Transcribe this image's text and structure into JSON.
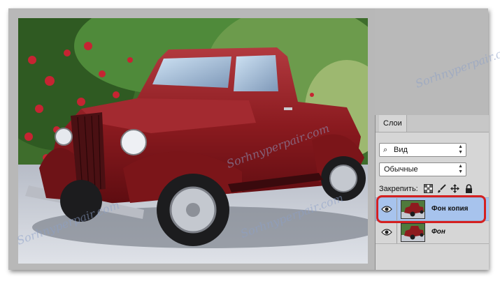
{
  "watermark": "Sorhnyperpair.com",
  "layers_panel": {
    "tab_label": "Слои",
    "filter_dropdown": {
      "icon": "search-icon",
      "value": "Вид"
    },
    "blend_dropdown": {
      "value": "Обычные"
    },
    "lock": {
      "label": "Закрепить:",
      "icons": [
        "lock-transparent-pixels-icon",
        "lock-image-pixels-icon",
        "lock-position-icon",
        "lock-all-icon"
      ]
    },
    "layers": [
      {
        "name": "Фон копия",
        "selected": true,
        "visible": true
      },
      {
        "name": "Фон",
        "selected": false,
        "visible": true
      }
    ]
  },
  "colors": {
    "selected_layer": "#a7c3ed",
    "highlight_outline": "#d42020",
    "truck_red": "#8e1b1f"
  }
}
